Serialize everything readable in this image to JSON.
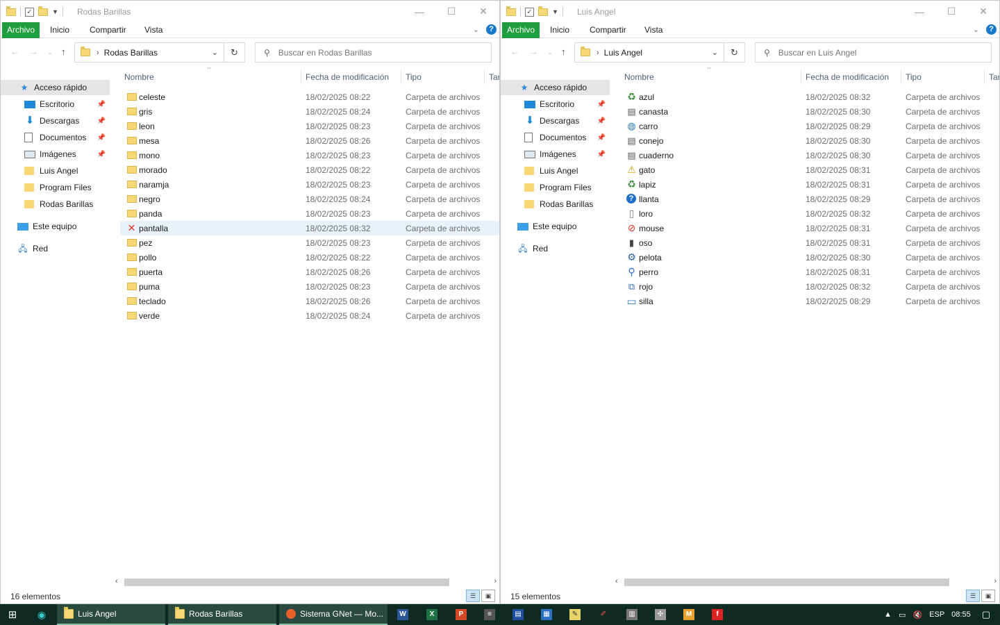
{
  "windows": [
    {
      "title": "Rodas Barillas",
      "ribbon": {
        "archivo": "Archivo",
        "inicio": "Inicio",
        "compartir": "Compartir",
        "vista": "Vista"
      },
      "address": "Rodas Barillas",
      "search_placeholder": "Buscar en Rodas Barillas",
      "nav": {
        "quick_access": "Acceso rápido",
        "escritorio": "Escritorio",
        "descargas": "Descargas",
        "documentos": "Documentos",
        "imagenes": "Imágenes",
        "luis_angel": "Luis Angel",
        "program_files": "Program Files",
        "rodas_barillas": "Rodas Barillas",
        "este_equipo": "Este equipo",
        "red": "Red"
      },
      "columns": {
        "name": "Nombre",
        "date": "Fecha de modificación",
        "type": "Tipo",
        "size": "Tar"
      },
      "rows": [
        {
          "icon": "folder-icon",
          "name": "celeste",
          "date": "18/02/2025 08:22",
          "type": "Carpeta de archivos"
        },
        {
          "icon": "folder-icon",
          "name": "gris",
          "date": "18/02/2025 08:24",
          "type": "Carpeta de archivos"
        },
        {
          "icon": "folder-icon",
          "name": "leon",
          "date": "18/02/2025 08:23",
          "type": "Carpeta de archivos"
        },
        {
          "icon": "folder-icon",
          "name": "mesa",
          "date": "18/02/2025 08:26",
          "type": "Carpeta de archivos"
        },
        {
          "icon": "folder-icon",
          "name": "mono",
          "date": "18/02/2025 08:23",
          "type": "Carpeta de archivos"
        },
        {
          "icon": "folder-icon",
          "name": "morado",
          "date": "18/02/2025 08:22",
          "type": "Carpeta de archivos"
        },
        {
          "icon": "folder-icon",
          "name": "naramja",
          "date": "18/02/2025 08:23",
          "type": "Carpeta de archivos"
        },
        {
          "icon": "folder-icon",
          "name": "negro",
          "date": "18/02/2025 08:24",
          "type": "Carpeta de archivos"
        },
        {
          "icon": "folder-icon",
          "name": "panda",
          "date": "18/02/2025 08:23",
          "type": "Carpeta de archivos"
        },
        {
          "icon": "red-x-icon",
          "name": "pantalla",
          "date": "18/02/2025 08:32",
          "type": "Carpeta de archivos"
        },
        {
          "icon": "folder-icon",
          "name": "pez",
          "date": "18/02/2025 08:23",
          "type": "Carpeta de archivos"
        },
        {
          "icon": "folder-icon",
          "name": "pollo",
          "date": "18/02/2025 08:22",
          "type": "Carpeta de archivos"
        },
        {
          "icon": "folder-icon",
          "name": "puerta",
          "date": "18/02/2025 08:26",
          "type": "Carpeta de archivos"
        },
        {
          "icon": "folder-icon",
          "name": "puma",
          "date": "18/02/2025 08:23",
          "type": "Carpeta de archivos"
        },
        {
          "icon": "folder-icon",
          "name": "teclado",
          "date": "18/02/2025 08:26",
          "type": "Carpeta de archivos"
        },
        {
          "icon": "folder-icon",
          "name": "verde",
          "date": "18/02/2025 08:24",
          "type": "Carpeta de archivos"
        }
      ],
      "status": "16 elementos"
    },
    {
      "title": "Luis Angel",
      "ribbon": {
        "archivo": "Archivo",
        "inicio": "Inicio",
        "compartir": "Compartir",
        "vista": "Vista"
      },
      "address": "Luis Angel",
      "search_placeholder": "Buscar en Luis Angel",
      "nav": {
        "quick_access": "Acceso rápido",
        "escritorio": "Escritorio",
        "descargas": "Descargas",
        "documentos": "Documentos",
        "imagenes": "Imágenes",
        "luis_angel": "Luis Angel",
        "program_files": "Program Files",
        "rodas_barillas": "Rodas Barillas",
        "este_equipo": "Este equipo",
        "red": "Red"
      },
      "columns": {
        "name": "Nombre",
        "date": "Fecha de modificación",
        "type": "Tipo",
        "size": "Tar"
      },
      "rows": [
        {
          "icon": "recycle-icon",
          "name": "azul",
          "date": "18/02/2025 08:32",
          "type": "Carpeta de archivos"
        },
        {
          "icon": "printer-icon",
          "name": "canasta",
          "date": "18/02/2025 08:30",
          "type": "Carpeta de archivos"
        },
        {
          "icon": "globe-icon",
          "name": "carro",
          "date": "18/02/2025 08:29",
          "type": "Carpeta de archivos"
        },
        {
          "icon": "printer-icon",
          "name": "conejo",
          "date": "18/02/2025 08:30",
          "type": "Carpeta de archivos"
        },
        {
          "icon": "printer-icon",
          "name": "cuaderno",
          "date": "18/02/2025 08:30",
          "type": "Carpeta de archivos"
        },
        {
          "icon": "warning-icon",
          "name": "gato",
          "date": "18/02/2025 08:31",
          "type": "Carpeta de archivos"
        },
        {
          "icon": "recycle-icon",
          "name": "lapiz",
          "date": "18/02/2025 08:31",
          "type": "Carpeta de archivos"
        },
        {
          "icon": "help-icon",
          "name": "llanta",
          "date": "18/02/2025 08:29",
          "type": "Carpeta de archivos"
        },
        {
          "icon": "document-icon",
          "name": "loro",
          "date": "18/02/2025 08:32",
          "type": "Carpeta de archivos"
        },
        {
          "icon": "blocked-icon",
          "name": "mouse",
          "date": "18/02/2025 08:31",
          "type": "Carpeta de archivos"
        },
        {
          "icon": "phone-icon",
          "name": "oso",
          "date": "18/02/2025 08:31",
          "type": "Carpeta de archivos"
        },
        {
          "icon": "settings-icon",
          "name": "pelota",
          "date": "18/02/2025 08:30",
          "type": "Carpeta de archivos"
        },
        {
          "icon": "search-icon",
          "name": "perro",
          "date": "18/02/2025 08:31",
          "type": "Carpeta de archivos"
        },
        {
          "icon": "network-icon",
          "name": "rojo",
          "date": "18/02/2025 08:32",
          "type": "Carpeta de archivos"
        },
        {
          "icon": "monitor-icon",
          "name": "silla",
          "date": "18/02/2025 08:29",
          "type": "Carpeta de archivos"
        }
      ],
      "status": "15 elementos"
    }
  ],
  "taskbar": {
    "apps": [
      "Luis Angel",
      "Rodas Barillas",
      "Sistema GNet — Mo..."
    ],
    "pinned": [
      "word-icon",
      "excel-icon",
      "powerpoint-icon",
      "app-icon",
      "app-icon",
      "app-icon",
      "notes-icon",
      "app-icon",
      "app-icon",
      "app-icon",
      "app-icon",
      "app-icon"
    ],
    "lang": "ESP",
    "time": "08:55"
  },
  "colors": {
    "ribbon_accent": "#1e9e3c",
    "taskbar": "#0e2a22",
    "folder": "#f8d775"
  }
}
